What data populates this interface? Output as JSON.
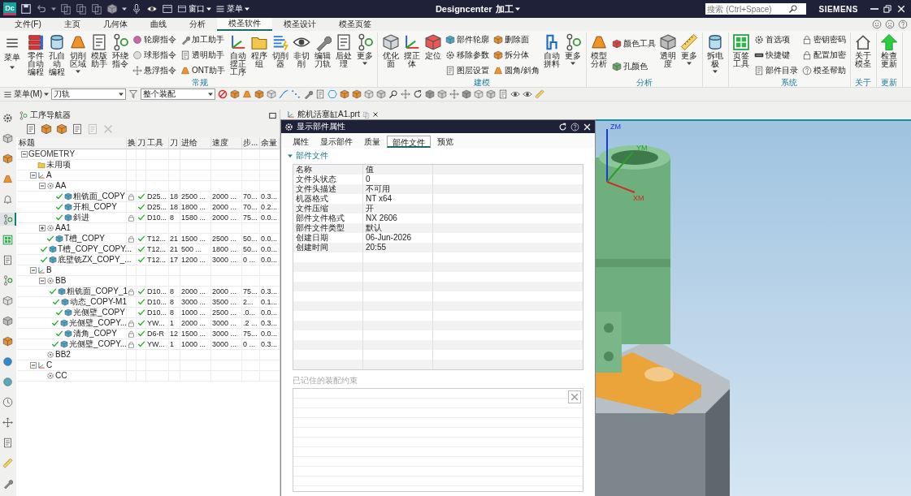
{
  "title_bar": {
    "logo": "Dc",
    "window_menu": "窗口",
    "menu": "菜单",
    "app_name": "Designcenter",
    "app_mode": "加工",
    "search": {
      "placeholder": "搜索 (Ctrl+Space)"
    },
    "brand": "SIEMENS"
  },
  "menu_tabs": [
    {
      "label": "文件(F)",
      "selected": false
    },
    {
      "label": "主页",
      "selected": false
    },
    {
      "label": "几何体",
      "selected": false
    },
    {
      "label": "曲线",
      "selected": false
    },
    {
      "label": "分析",
      "selected": false
    },
    {
      "label": "模圣软件",
      "selected": true
    },
    {
      "label": "模圣设计",
      "selected": false
    },
    {
      "label": "模圣页签",
      "selected": false
    }
  ],
  "ribbon": {
    "menu_button": "菜单",
    "groups": [
      {
        "label": "常规",
        "items": [
          {
            "kind": "large",
            "label": "零件自动编程",
            "dropdown": false
          },
          {
            "kind": "large",
            "label": "孔自动编程",
            "dropdown": false
          },
          {
            "kind": "large",
            "label": "切削区域",
            "dropdown": true
          },
          {
            "kind": "large",
            "label": "模版助手",
            "dropdown": false
          },
          {
            "kind": "large",
            "label": "环绕指令",
            "dropdown": false
          },
          {
            "kind": "stack",
            "items": [
              "轮廓指令",
              "球形指令",
              "悬浮指令"
            ]
          },
          {
            "kind": "stack",
            "items": [
              "加工助手",
              "透明助手",
              "ONT助手"
            ]
          },
          {
            "kind": "large",
            "label": "自动摆正工序",
            "dropdown": false
          },
          {
            "kind": "large",
            "label": "程序组",
            "dropdown": false
          },
          {
            "kind": "large",
            "label": "切削器",
            "dropdown": false
          },
          {
            "kind": "large",
            "label": "非切削",
            "dropdown": false
          },
          {
            "kind": "large",
            "label": "编辑刀轨",
            "dropdown": false
          },
          {
            "kind": "large",
            "label": "后处理",
            "dropdown": false
          },
          {
            "kind": "large",
            "label": "更多",
            "dropdown": true
          }
        ]
      },
      {
        "label": "建模",
        "items": [
          {
            "kind": "large",
            "label": "优化面",
            "dropdown": false
          },
          {
            "kind": "large",
            "label": "摆正体",
            "dropdown": false
          },
          {
            "kind": "large",
            "label": "定位",
            "dropdown": false
          },
          {
            "kind": "stack",
            "items": [
              "部件轮廓",
              "移除参数",
              "图层设置"
            ]
          },
          {
            "kind": "stack",
            "items": [
              "删除面",
              "拆分体",
              "圆角/斜角"
            ]
          },
          {
            "kind": "large",
            "label": "自动拼料",
            "dropdown": false
          },
          {
            "kind": "large",
            "label": "更多",
            "dropdown": true
          }
        ]
      },
      {
        "label": "分析",
        "items": [
          {
            "kind": "large",
            "label": "模型分析",
            "dropdown": false
          },
          {
            "kind": "stack",
            "items": [
              "颜色工具",
              "孔颜色"
            ]
          },
          {
            "kind": "large",
            "label": "透明度",
            "dropdown": false
          },
          {
            "kind": "large",
            "label": "更多",
            "dropdown": true
          }
        ]
      },
      {
        "items": [
          {
            "kind": "large",
            "label": "拆电极",
            "dropdown": true
          }
        ]
      },
      {
        "label": "系统",
        "items": [
          {
            "kind": "large",
            "label": "页签工具",
            "dropdown": false
          },
          {
            "kind": "stack",
            "items": [
              "首选项",
              "快捷键",
              "部件目录"
            ]
          },
          {
            "kind": "stack",
            "items": [
              "密钥密码",
              "配置加密",
              "模圣帮助"
            ]
          }
        ]
      },
      {
        "label": "关于",
        "items": [
          {
            "kind": "large",
            "label": "关于模圣",
            "dropdown": false
          }
        ]
      },
      {
        "label": "更新",
        "items": [
          {
            "kind": "large",
            "label": "检查更新",
            "dropdown": false
          }
        ]
      }
    ]
  },
  "toolbar": {
    "menu": "菜单(M)",
    "filter": "刀轨",
    "scope": "整个装配"
  },
  "sidebar_tabs": [
    {
      "selected": false
    },
    {
      "selected": false
    },
    {
      "selected": false
    },
    {
      "selected": false
    },
    {
      "selected": false
    },
    {
      "selected": true
    },
    {
      "selected": false
    },
    {
      "selected": false
    },
    {
      "selected": false
    },
    {
      "selected": false
    },
    {
      "selected": false
    },
    {
      "selected": false
    },
    {
      "selected": false
    },
    {
      "selected": false
    },
    {
      "selected": false
    },
    {
      "selected": false
    },
    {
      "selected": false
    },
    {
      "selected": false
    },
    {
      "selected": false
    }
  ],
  "navigator": {
    "title": "工序导航器",
    "columns": [
      "标题",
      "换",
      "刀",
      "工具",
      "刀",
      "进给",
      "速度",
      "步...",
      "余量"
    ],
    "tree": [
      {
        "kind": "geometry",
        "label": "GEOMETRY",
        "expanded": true,
        "children": [
          {
            "kind": "unused",
            "label": "未用项"
          },
          {
            "kind": "mcs",
            "label": "A",
            "expanded": true,
            "children": [
              {
                "kind": "workpiece",
                "label": "AA",
                "expanded": true,
                "children": [
                  {
                    "kind": "operation",
                    "label": "粗铣面_COPY",
                    "locked": true,
                    "complete": true,
                    "tool": "D25...",
                    "tool_number": "18",
                    "feed": "2500 ...",
                    "speed": "2000 ...",
                    "step": "70...",
                    "stock": "0.3..."
                  },
                  {
                    "kind": "operation",
                    "label": "开粗_COPY",
                    "locked": false,
                    "complete": true,
                    "tool": "D25...",
                    "tool_number": "18",
                    "feed": "1800 ...",
                    "speed": "2000 ...",
                    "step": "70...",
                    "stock": "0.2..."
                  },
                  {
                    "kind": "operation",
                    "label": "斜进",
                    "locked": true,
                    "complete": true,
                    "tool": "D10...",
                    "tool_number": "8",
                    "feed": "1580 ...",
                    "speed": "2000 ...",
                    "step": "75...",
                    "stock": "0.0..."
                  }
                ]
              },
              {
                "kind": "workpiece",
                "label": "AA1",
                "expanded": false
              },
              {
                "kind": "operation",
                "label": "T槽_COPY",
                "locked": true,
                "complete": true,
                "tool": "T12...",
                "tool_number": "21",
                "feed": "1500 ...",
                "speed": "2500 ...",
                "step": "50...",
                "stock": "0.0..."
              },
              {
                "kind": "operation",
                "label": "T槽_COPY_COPY...",
                "locked": false,
                "complete": true,
                "tool": "T12...",
                "tool_number": "21",
                "feed": "500 ...",
                "speed": "1800 ...",
                "step": "50...",
                "stock": "0.0..."
              },
              {
                "kind": "operation",
                "label": "底壁铣ZX_COPY_...",
                "locked": false,
                "complete": true,
                "tool": "T12...",
                "tool_number": "17",
                "feed": "1200 ...",
                "speed": "3000 ...",
                "step": "0 ...",
                "stock": "0.0..."
              }
            ]
          },
          {
            "kind": "mcs",
            "label": "B",
            "expanded": true,
            "children": [
              {
                "kind": "workpiece",
                "label": "BB",
                "expanded": true,
                "children": [
                  {
                    "kind": "operation",
                    "label": "粗铣面_COPY_1",
                    "locked": true,
                    "complete": true,
                    "tool": "D10...",
                    "tool_number": "8",
                    "feed": "2000 ...",
                    "speed": "2000 ...",
                    "step": "75...",
                    "stock": "0.3..."
                  },
                  {
                    "kind": "operation",
                    "label": "动态_COPY-M1",
                    "locked": false,
                    "complete": true,
                    "tool": "D10...",
                    "tool_number": "8",
                    "feed": "3000 ...",
                    "speed": "3500 ...",
                    "step": "2...",
                    "stock": "0.1..."
                  },
                  {
                    "kind": "operation",
                    "label": "光侧壁_COPY",
                    "locked": false,
                    "complete": true,
                    "tool": "D10...",
                    "tool_number": "8",
                    "feed": "1000 ...",
                    "speed": "2500 ...",
                    "step": ".0...",
                    "stock": "0.0..."
                  },
                  {
                    "kind": "operation",
                    "label": "光侧壁_COPY...",
                    "locked": true,
                    "complete": true,
                    "tool": "YW...",
                    "tool_number": "1",
                    "feed": "2000 ...",
                    "speed": "3000 ...",
                    "step": ".2 ...",
                    "stock": "0.3..."
                  },
                  {
                    "kind": "operation",
                    "label": "清角_COPY",
                    "locked": true,
                    "complete": true,
                    "tool": "D6-R",
                    "tool_number": "12",
                    "feed": "1500 ...",
                    "speed": "3000 ...",
                    "step": "75...",
                    "stock": "0.0..."
                  },
                  {
                    "kind": "operation",
                    "label": "光侧壁_COPY...",
                    "locked": true,
                    "complete": true,
                    "tool": "YW...",
                    "tool_number": "1",
                    "feed": "1000 ...",
                    "speed": "3000 ...",
                    "step": "0 ...",
                    "stock": "0.3..."
                  }
                ]
              },
              {
                "kind": "workpiece",
                "label": "BB2"
              }
            ]
          },
          {
            "kind": "mcs",
            "label": "C",
            "expanded": true,
            "children": [
              {
                "kind": "workpiece",
                "label": "CC"
              }
            ]
          }
        ]
      }
    ]
  },
  "part_tab": {
    "label": "舵机活塞缸A1.prt"
  },
  "dialog": {
    "title": "显示部件属性",
    "tabs": [
      {
        "label": "属性",
        "selected": false
      },
      {
        "label": "显示部件",
        "selected": false
      },
      {
        "label": "质量",
        "selected": false
      },
      {
        "label": "部件文件",
        "selected": true
      },
      {
        "label": "预览",
        "selected": false
      }
    ],
    "section": {
      "label": "部件文件",
      "expanded": true
    },
    "table": {
      "columns": [
        "名称",
        "值"
      ],
      "rows": [
        [
          "文件头状态",
          "0"
        ],
        [
          "文件头描述",
          "不可用"
        ],
        [
          "机器格式",
          "NT x64"
        ],
        [
          "文件压缩",
          "开"
        ],
        [
          "部件文件格式",
          "NX 2606"
        ],
        [
          "部件文件类型",
          "默认"
        ],
        [
          "创建日期",
          "06-Jun-2026"
        ],
        [
          "创建时间",
          "20:55"
        ]
      ]
    },
    "list_label": "已记住的装配约束"
  },
  "viewport": {
    "axis_labels": [
      "ZM",
      "YM",
      "XM"
    ]
  }
}
